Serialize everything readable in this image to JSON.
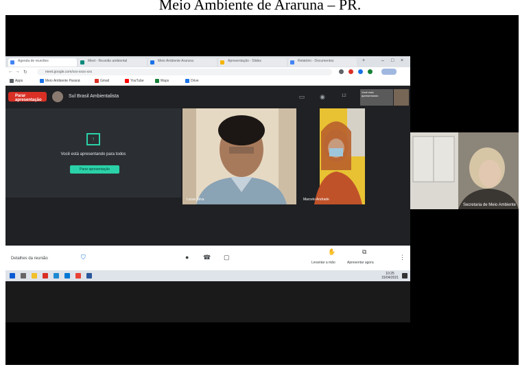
{
  "caption": "Meio Ambiente de Araruna – PR.",
  "browser": {
    "tabs": [
      {
        "label": "Agenda de reuniões",
        "icon": "calendar-icon",
        "color": "#4285f4"
      },
      {
        "label": "Meet - Reunião ambiental",
        "icon": "meet-icon",
        "color": "#00897b"
      },
      {
        "label": "Meio Ambiente Araruna",
        "icon": "doc-icon",
        "color": "#1a73e8"
      },
      {
        "label": "Apresentação - Slides",
        "icon": "slides-icon",
        "color": "#f4b400"
      },
      {
        "label": "Relatório - Documentos",
        "icon": "docs-icon",
        "color": "#4285f4"
      }
    ],
    "url": "meet.google.com/xxx-xxxx-xxx",
    "bookmarks": [
      {
        "label": "Apps",
        "color": "#5f6368"
      },
      {
        "label": "Meio Ambiente Paraná",
        "color": "#1a73e8"
      },
      {
        "label": "Gmail",
        "color": "#d93025"
      },
      {
        "label": "YouTube",
        "color": "#ff0000"
      },
      {
        "label": "Maps",
        "color": "#188038"
      },
      {
        "label": "Drive",
        "color": "#1a73e8"
      }
    ]
  },
  "meeting": {
    "stop_presenting": "Parar apresentação",
    "presenter_name": "Sul Brasil Ambientalista",
    "participant_count": "12",
    "mini_thumb_label": "Você está apresentando",
    "present_text": "Você está apresentando para todos",
    "present_button": "Parar apresentação",
    "tiles": [
      {
        "name": "Lucas Silva"
      },
      {
        "name": "Marcelo Andrade"
      }
    ]
  },
  "bottom_bar": {
    "meeting_details": "Detalhes da reunião",
    "raise_hand": "Levantar a mão",
    "present_now": "Apresentar agora",
    "more_options": "⋮"
  },
  "taskbar": {
    "time": "10:25",
    "date": "15/04/2021",
    "icons": [
      {
        "name": "start-icon",
        "color": "#0a5bd3"
      },
      {
        "name": "search-icon",
        "color": "#666666"
      },
      {
        "name": "folder-icon",
        "color": "#f2c02a"
      },
      {
        "name": "mail-icon",
        "color": "#d93025"
      },
      {
        "name": "edge-icon",
        "color": "#1f8ad2"
      },
      {
        "name": "store-icon",
        "color": "#0078d4"
      },
      {
        "name": "chrome-icon",
        "color": "#e94235"
      },
      {
        "name": "word-icon",
        "color": "#2b579a"
      }
    ]
  },
  "camera": {
    "name": "Secretaria de Meio Ambiente"
  }
}
